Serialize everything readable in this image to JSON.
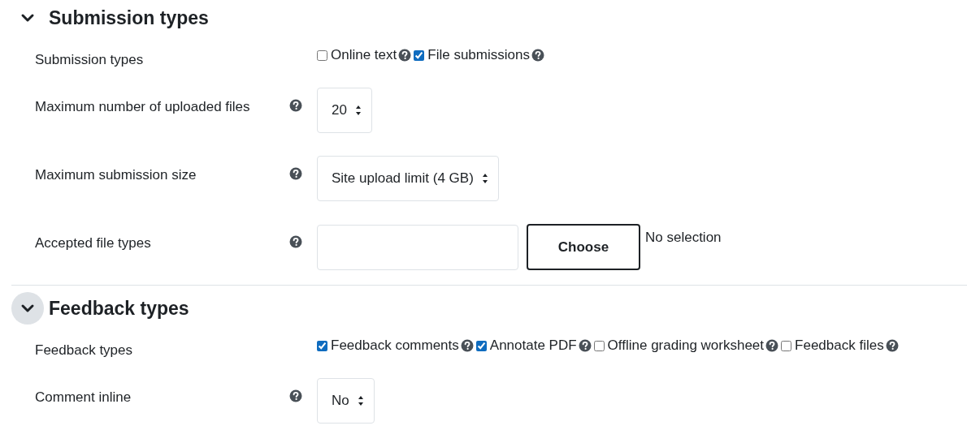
{
  "sections": [
    {
      "title": "Submission types",
      "expanded": true,
      "focused": false,
      "rows": [
        {
          "kind": "checkboxes",
          "label": "Submission types",
          "help": false,
          "options": [
            {
              "label": "Online text",
              "checked": false
            },
            {
              "label": "File submissions",
              "checked": true
            }
          ]
        },
        {
          "kind": "select",
          "label": "Maximum number of uploaded files",
          "help": true,
          "value": "20"
        },
        {
          "kind": "select",
          "label": "Maximum submission size",
          "help": true,
          "value": "Site upload limit (4 GB)"
        },
        {
          "kind": "filepicker",
          "label": "Accepted file types",
          "help": true,
          "button": "Choose",
          "status": "No selection"
        }
      ]
    },
    {
      "title": "Feedback types",
      "expanded": true,
      "focused": true,
      "rows": [
        {
          "kind": "checkboxes",
          "label": "Feedback types",
          "help": false,
          "options": [
            {
              "label": "Feedback comments",
              "checked": true
            },
            {
              "label": "Annotate PDF",
              "checked": true
            },
            {
              "label": "Offline grading worksheet",
              "checked": false
            },
            {
              "label": "Feedback files",
              "checked": false
            }
          ]
        },
        {
          "kind": "select",
          "label": "Comment inline",
          "help": true,
          "value": "No"
        }
      ]
    }
  ]
}
